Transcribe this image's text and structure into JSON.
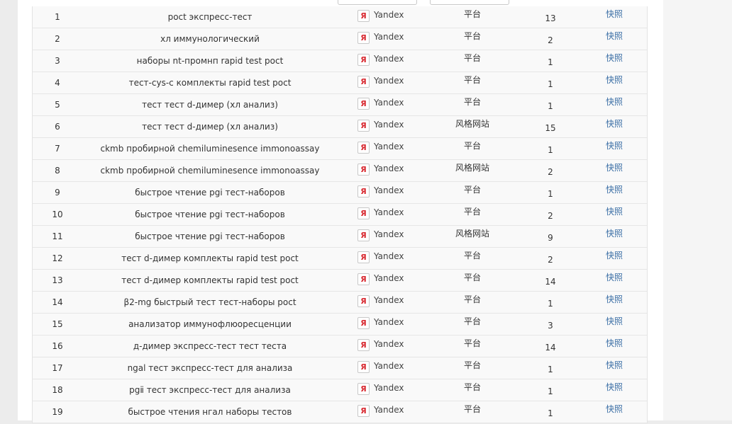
{
  "engine_name": "Yandex",
  "engine_badge": "Я",
  "snapshot_label": "快照",
  "rows": [
    {
      "num": "1",
      "keyword": "poct экспресс-тест",
      "platform": "平台",
      "count": "13"
    },
    {
      "num": "2",
      "keyword": "хл иммунологический",
      "platform": "平台",
      "count": "2"
    },
    {
      "num": "3",
      "keyword": "наборы nt-промнп rapid test poct",
      "platform": "平台",
      "count": "1"
    },
    {
      "num": "4",
      "keyword": "тест-cys-c комплекты rapid test poct",
      "platform": "平台",
      "count": "1"
    },
    {
      "num": "5",
      "keyword": "тест тест d-димер (хл анализ)",
      "platform": "平台",
      "count": "1"
    },
    {
      "num": "6",
      "keyword": "тест тест d-димер (хл анализ)",
      "platform": "风格网站",
      "count": "15"
    },
    {
      "num": "7",
      "keyword": "ckmb пробирной chemiluminesence immonoassay",
      "platform": "平台",
      "count": "1"
    },
    {
      "num": "8",
      "keyword": "ckmb пробирной chemiluminesence immonoassay",
      "platform": "风格网站",
      "count": "2"
    },
    {
      "num": "9",
      "keyword": "быстрое чтение pgi тест-наборов",
      "platform": "平台",
      "count": "1"
    },
    {
      "num": "10",
      "keyword": "быстрое чтение pgi тест-наборов",
      "platform": "平台",
      "count": "2"
    },
    {
      "num": "11",
      "keyword": "быстрое чтение pgi тест-наборов",
      "platform": "风格网站",
      "count": "9"
    },
    {
      "num": "12",
      "keyword": "тест d-димер комплекты rapid test poct",
      "platform": "平台",
      "count": "2"
    },
    {
      "num": "13",
      "keyword": "тест d-димер комплекты rapid test poct",
      "platform": "平台",
      "count": "14"
    },
    {
      "num": "14",
      "keyword": "β2-mg быстрый тест тест-наборы poct",
      "platform": "平台",
      "count": "1"
    },
    {
      "num": "15",
      "keyword": "анализатор иммунофлюоресценции",
      "platform": "平台",
      "count": "3"
    },
    {
      "num": "16",
      "keyword": "д-димер экспресс-тест тест теста",
      "platform": "平台",
      "count": "14"
    },
    {
      "num": "17",
      "keyword": "ngal тест экспресс-тест для анализа",
      "platform": "平台",
      "count": "1"
    },
    {
      "num": "18",
      "keyword": "pgⅱ тест экспресс-тест для анализа",
      "platform": "平台",
      "count": "1"
    },
    {
      "num": "19",
      "keyword": "быстрое чтения нгал наборы тестов",
      "platform": "平台",
      "count": "1"
    }
  ]
}
